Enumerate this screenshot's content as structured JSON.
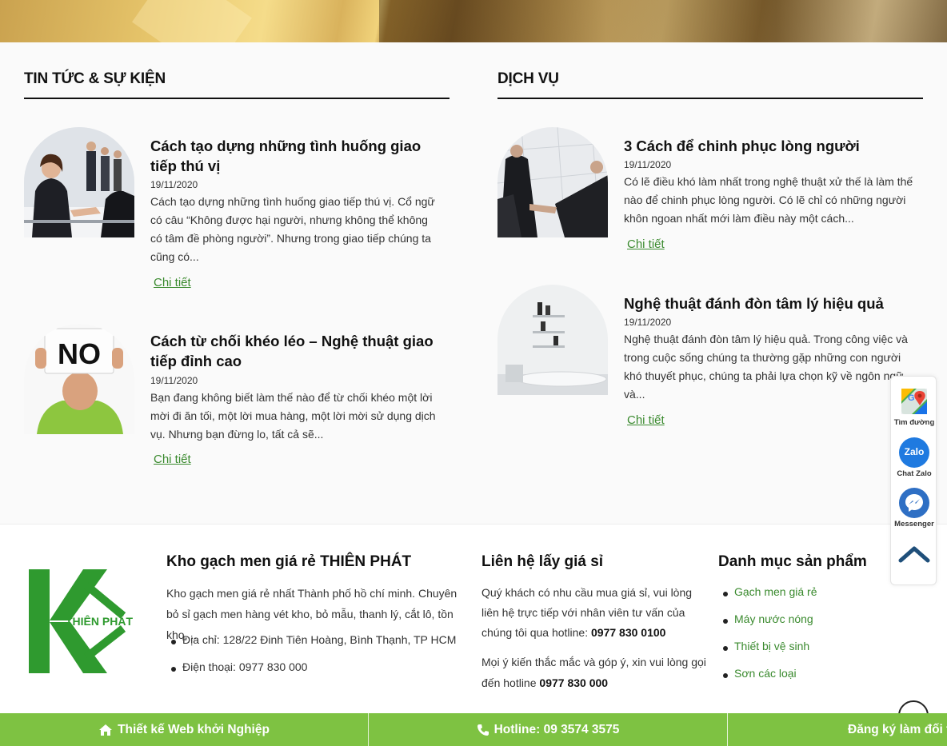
{
  "news": {
    "heading": "TIN TỨC & SỰ KIỆN",
    "articles": [
      {
        "title": "Cách tạo dựng những tình huống giao tiếp thú vị",
        "date": "19/11/2020",
        "excerpt": "Cách tạo dựng những tình huống giao tiếp thú vị. Cổ ngữ có câu “Không được hại người, nhưng không thể không có tâm đề phòng người”. Nhưng trong giao tiếp chúng ta cũng có...",
        "more": "Chi tiết"
      },
      {
        "title": "Cách từ chối khéo léo – Nghệ thuật giao tiếp đỉnh cao",
        "date": "19/11/2020",
        "excerpt": "Bạn đang không biết làm thế nào để từ chối khéo một lời mời đi ăn tối, một lời mua hàng, một lời mời sử dụng dịch vụ. Nhưng bạn đừng lo, tất cả sẽ...",
        "more": "Chi tiết",
        "image_sign_text": "NO"
      }
    ]
  },
  "services": {
    "heading": "DỊCH VỤ",
    "articles": [
      {
        "title": "3 Cách để chinh phục lòng người",
        "date": "19/11/2020",
        "excerpt": "Có lẽ điều khó làm nhất trong nghệ thuật xử thế là làm thế nào để chinh phục lòng người. Có lẽ chỉ có những người khôn ngoan nhất mới làm điều này một cách...",
        "more": "Chi tiết"
      },
      {
        "title": "Nghệ thuật đánh đòn tâm lý hiệu quả",
        "date": "19/11/2020",
        "excerpt": "Nghệ thuật đánh đòn tâm lý hiệu quả. Trong công việc và trong cuộc sống chúng ta thường gặp những con người khó thuyết phục, chúng ta phải lựa chọn kỹ về ngôn ngữ và...",
        "more": "Chi tiết"
      }
    ]
  },
  "footer": {
    "logo_text": "THIÊN PHÁT",
    "about": {
      "heading": "Kho gạch men giá rẻ THIÊN PHÁT",
      "text": "Kho gạch men giá rẻ nhất Thành phố hồ chí minh. Chuyên bỏ sỉ gạch men hàng vét kho, bỏ mẫu, thanh lý, cắt lô, tồn kho,...",
      "address": "Địa chỉ: 128/22 Đinh Tiên Hoàng, Bình Thạnh, TP HCM",
      "phone": "Điện thoại: 0977 830 000"
    },
    "contact": {
      "heading": "Liên hệ lấy giá sỉ",
      "text1": "Quý khách có nhu cầu mua giá sỉ, vui lòng liên hệ trực tiếp với nhân viên tư vấn của chúng tôi qua hotline: ",
      "hotline1": "0977 830 0100",
      "text2": "Mọi ý kiến thắc mắc và góp ý, xin vui lòng gọi đến hotline ",
      "hotline2": "0977 830 000"
    },
    "categories": {
      "heading": "Danh mục sản phẩm",
      "items": [
        "Gạch men giá rẻ",
        "Máy nước nóng",
        "Thiết bị vệ sinh",
        "Sơn các loại"
      ]
    }
  },
  "widget": {
    "maps_label": "Tìm đường",
    "zalo_label": "Chat Zalo",
    "zalo_icon_text": "Zalo",
    "messenger_label": "Messenger"
  },
  "bottombar": {
    "item1": "Thiết kế Web khởi Nghiệp",
    "item2": "Hotline: 09 3574 3575",
    "item3": "Đăng ký làm đối tác"
  },
  "colors": {
    "accent_green": "#3a8a2e",
    "bar_green": "#7ec242",
    "zalo_blue": "#1f7ae0",
    "messenger_blue": "#2e6fc4"
  }
}
